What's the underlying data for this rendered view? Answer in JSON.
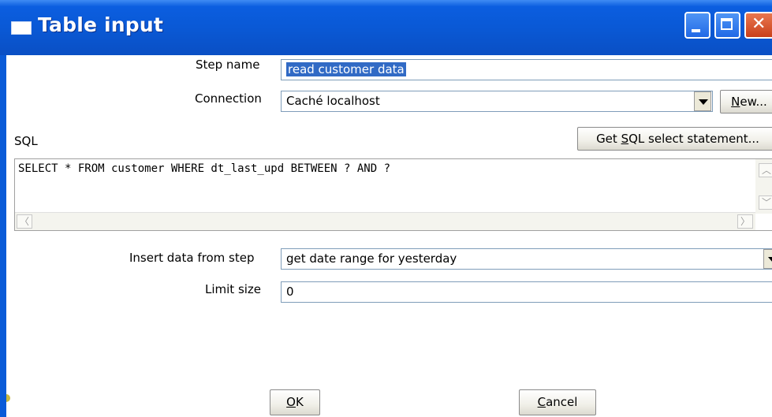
{
  "window": {
    "title": "Table input"
  },
  "form": {
    "step_name_label": "Step name",
    "step_name_value": "read customer data",
    "connection_label": "Connection",
    "connection_value": "Caché localhost",
    "new_button_underlined": "N",
    "new_button_rest": "ew...",
    "sql_label": "SQL",
    "get_sql_pre": "Get ",
    "get_sql_underlined": "S",
    "get_sql_post": "QL select statement...",
    "sql_text": "SELECT * FROM customer WHERE dt_last_upd BETWEEN ? AND ?",
    "insert_label": "Insert data from step",
    "insert_value": "get date range for yesterday",
    "limit_label": "Limit size",
    "limit_value": "0"
  },
  "buttons": {
    "ok_underlined": "O",
    "ok_rest": "K",
    "cancel_underlined": "C",
    "cancel_rest": "ancel"
  },
  "icons": [
    "window-icon",
    "minimize-icon",
    "maximize-icon",
    "close-icon",
    "dropdown-arrow-icon",
    "scroll-left-icon",
    "scroll-right-icon",
    "scroll-up-icon",
    "scroll-down-icon"
  ]
}
